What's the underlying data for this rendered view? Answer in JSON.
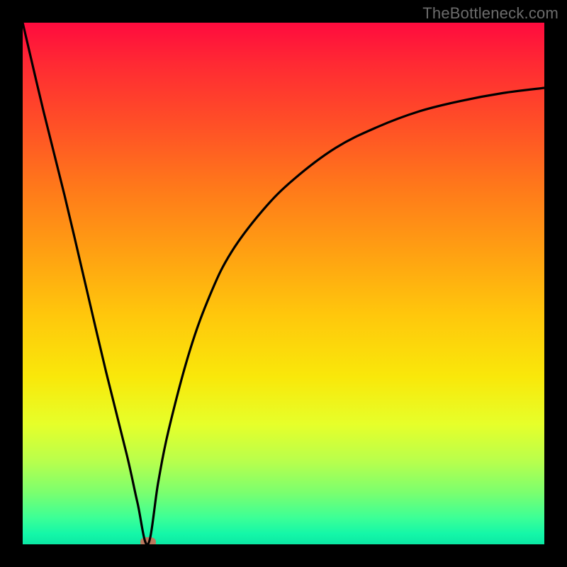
{
  "watermark": {
    "text": "TheBottleneck.com"
  },
  "chart_data": {
    "type": "line",
    "title": "",
    "xlabel": "",
    "ylabel": "",
    "x_range": [
      0,
      100
    ],
    "y_range": [
      0,
      100
    ],
    "grid": false,
    "legend": false,
    "cusp_x": 24,
    "series": [
      {
        "name": "bottleneck-curve",
        "x": [
          0,
          4,
          8,
          12,
          16,
          20,
          22,
          24,
          26,
          28,
          32,
          36,
          40,
          46,
          52,
          60,
          68,
          76,
          84,
          92,
          100
        ],
        "values": [
          100,
          83,
          67,
          50,
          33,
          17,
          8,
          0,
          12,
          22,
          37,
          48,
          56,
          64,
          70,
          76,
          80,
          83,
          85,
          86.5,
          87.5
        ]
      }
    ],
    "background_gradient": {
      "direction": "vertical",
      "stops": [
        {
          "pos": 0.0,
          "color": "#ff0b3e"
        },
        {
          "pos": 0.32,
          "color": "#ff7a1a"
        },
        {
          "pos": 0.56,
          "color": "#ffc70c"
        },
        {
          "pos": 0.77,
          "color": "#e6ff2a"
        },
        {
          "pos": 0.95,
          "color": "#3bff97"
        },
        {
          "pos": 1.0,
          "color": "#0be8a4"
        }
      ]
    },
    "marker": {
      "x": 24,
      "y": 0,
      "color": "#cf6b57"
    },
    "frame_color": "#000000",
    "curve_color": "#000000"
  }
}
